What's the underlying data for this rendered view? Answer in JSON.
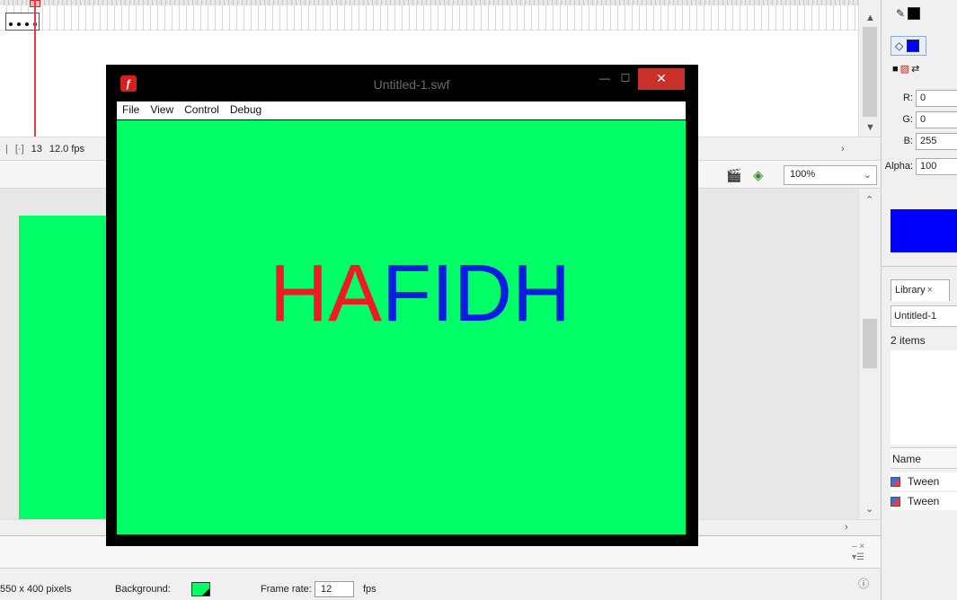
{
  "timeline": {
    "current_frame": "13",
    "frame_rate": "12.0 fps"
  },
  "edit_bar": {
    "zoom": "100%"
  },
  "player_window": {
    "title": "Untitled-1.swf",
    "menu": [
      "File",
      "View",
      "Control",
      "Debug"
    ],
    "content_text_red": "HA",
    "content_text_blue": "FIDH",
    "background_color": "#00ff66"
  },
  "properties": {
    "size": "550 x 400 pixels",
    "background_label": "Background:",
    "background_color": "#00ff66",
    "frame_rate_label": "Frame rate:",
    "frame_rate_value": "12",
    "fps_label": "fps"
  },
  "color_panel": {
    "fill_color": "#0000ff",
    "stroke_color": "#000000",
    "r_label": "R:",
    "r_value": "0",
    "g_label": "G:",
    "g_value": "0",
    "b_label": "B:",
    "b_value": "255",
    "alpha_label": "Alpha:",
    "alpha_value": "100"
  },
  "library": {
    "tab_label": "Library",
    "document": "Untitled-1",
    "count": "2 items",
    "name_header": "Name",
    "items": [
      {
        "name": "Tween",
        "icon": "graphic-symbol-icon"
      },
      {
        "name": "Tween",
        "icon": "graphic-symbol-icon"
      }
    ]
  },
  "icons": {
    "collapse": "collapse-icon",
    "help": "help-icon"
  }
}
